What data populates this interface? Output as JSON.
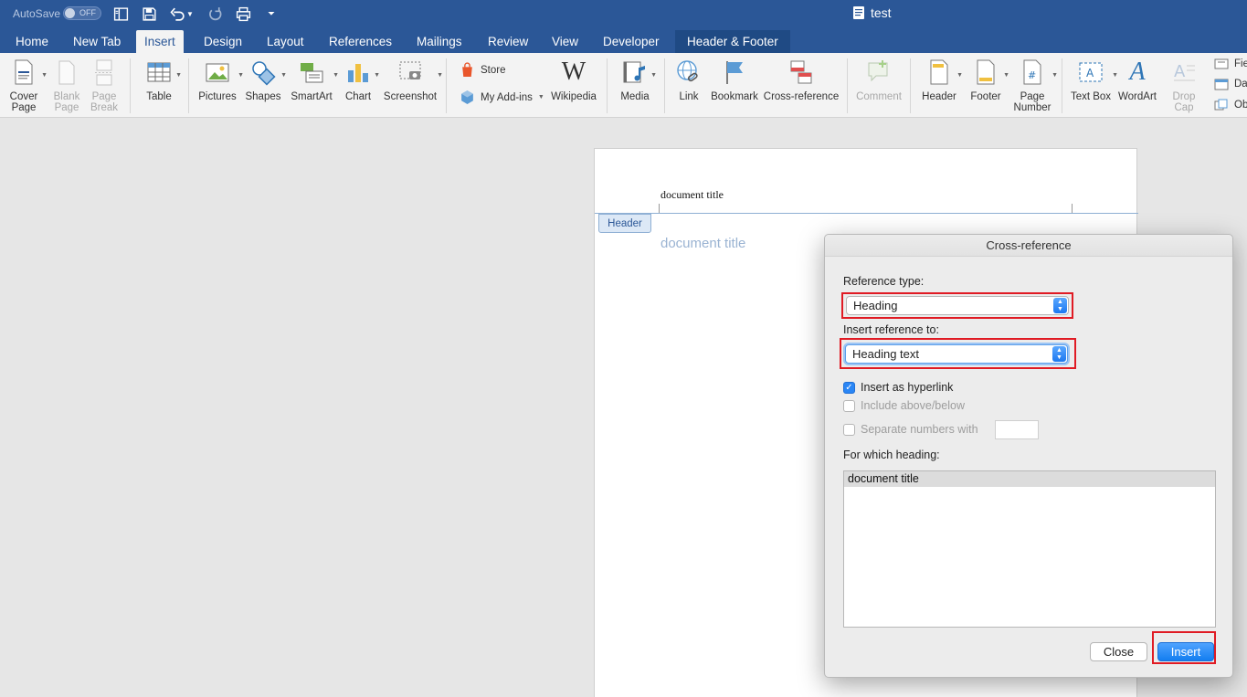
{
  "titlebar": {
    "autosave_label": "AutoSave",
    "autosave_state": "OFF",
    "document_name": "test"
  },
  "tabs": [
    "Home",
    "New Tab",
    "Insert",
    "Design",
    "Layout",
    "References",
    "Mailings",
    "Review",
    "View",
    "Developer",
    "Header & Footer"
  ],
  "active_tab": "Insert",
  "ribbon": {
    "cover_page": [
      "Cover",
      "Page"
    ],
    "blank_page": [
      "Blank",
      "Page"
    ],
    "page_break": [
      "Page",
      "Break"
    ],
    "table": "Table",
    "pictures": "Pictures",
    "shapes": "Shapes",
    "smartart": "SmartArt",
    "chart": "Chart",
    "screenshot": "Screenshot",
    "store": "Store",
    "my_addins": "My Add-ins",
    "wikipedia": "Wikipedia",
    "media": "Media",
    "link": "Link",
    "bookmark": "Bookmark",
    "cross_reference": "Cross-reference",
    "comment": "Comment",
    "header": "Header",
    "footer": "Footer",
    "page_number": [
      "Page",
      "Number"
    ],
    "text_box": "Text Box",
    "wordart": "WordArt",
    "drop_cap": [
      "Drop",
      "Cap"
    ],
    "field": "Fie",
    "date": "Da",
    "object": "Ob"
  },
  "document": {
    "header_text": "document title",
    "header_tag": "Header",
    "body_ghost_text": "document title"
  },
  "dialog": {
    "title": "Cross-reference",
    "reference_type_label": "Reference type:",
    "reference_type_value": "Heading",
    "insert_reference_label": "Insert reference to:",
    "insert_reference_value": "Heading text",
    "insert_as_hyperlink": "Insert as hyperlink",
    "insert_as_hyperlink_checked": true,
    "include_above_below": "Include above/below",
    "separate_numbers": "Separate numbers with",
    "for_which_label": "For which heading:",
    "headings": [
      "document title"
    ],
    "close_button": "Close",
    "insert_button": "Insert"
  },
  "colors": {
    "title_bar": "#2b5797",
    "highlight_box": "#e01b24",
    "primary_button": "#137ef0"
  }
}
